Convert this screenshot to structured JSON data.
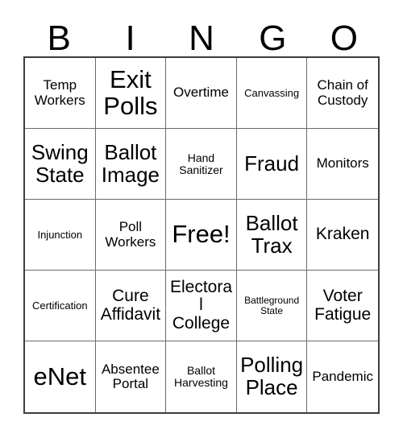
{
  "card": {
    "title": "BINGO",
    "header_letters": [
      "B",
      "I",
      "N",
      "G",
      "O"
    ],
    "colors": {
      "background": "#ffffff",
      "text": "#000000",
      "outer_border": "#3d3d3d",
      "inner_gridline": "#6b6b6b"
    },
    "grid": {
      "columns": 5,
      "rows": 5,
      "free_space": "Free!"
    },
    "cells": [
      {
        "label": "Temp Workers",
        "size": "lg",
        "lines": [
          "Temp",
          "Workers"
        ]
      },
      {
        "label": "Exit Polls",
        "size": "huge",
        "lines": [
          "Exit",
          "Polls"
        ]
      },
      {
        "label": "Overtime",
        "size": "lg",
        "lines": [
          "Overtime"
        ]
      },
      {
        "label": "Canvassing",
        "size": "sm",
        "lines": [
          "Canvassing"
        ]
      },
      {
        "label": "Chain of Custody",
        "size": "lg",
        "lines": [
          "Chain of",
          "Custody"
        ]
      },
      {
        "label": "Swing State",
        "size": "xxl",
        "lines": [
          "Swing",
          "State"
        ]
      },
      {
        "label": "Ballot Image",
        "size": "xxl",
        "lines": [
          "Ballot",
          "Image"
        ]
      },
      {
        "label": "Hand Sanitizer",
        "size": "md",
        "lines": [
          "Hand",
          "Sanitizer"
        ]
      },
      {
        "label": "Fraud",
        "size": "xxl",
        "lines": [
          "Fraud"
        ]
      },
      {
        "label": "Monitors",
        "size": "lg",
        "lines": [
          "Monitors"
        ]
      },
      {
        "label": "Injunction",
        "size": "sm",
        "lines": [
          "Injunction"
        ]
      },
      {
        "label": "Poll Workers",
        "size": "lg",
        "lines": [
          "Poll",
          "Workers"
        ]
      },
      {
        "label": "Free!",
        "size": "huge",
        "lines": [
          "Free!"
        ]
      },
      {
        "label": "Ballot Trax",
        "size": "xxl",
        "lines": [
          "Ballot",
          "Trax"
        ]
      },
      {
        "label": "Kraken",
        "size": "xl",
        "lines": [
          "Kraken"
        ]
      },
      {
        "label": "Certification",
        "size": "sm",
        "lines": [
          "Certification"
        ]
      },
      {
        "label": "Cure Affidavit",
        "size": "xl",
        "lines": [
          "Cure",
          "Affidavit"
        ]
      },
      {
        "label": "Electoral College",
        "size": "xl",
        "lines": [
          "Electoral",
          "College"
        ]
      },
      {
        "label": "Battleground State",
        "size": "xs",
        "lines": [
          "Battleground",
          "State"
        ]
      },
      {
        "label": "Voter Fatigue",
        "size": "xl",
        "lines": [
          "Voter",
          "Fatigue"
        ]
      },
      {
        "label": "eNet",
        "size": "huge",
        "lines": [
          "eNet"
        ]
      },
      {
        "label": "Absentee Portal",
        "size": "lg",
        "lines": [
          "Absentee",
          "Portal"
        ]
      },
      {
        "label": "Ballot Harvesting",
        "size": "md",
        "lines": [
          "Ballot",
          "Harvesting"
        ]
      },
      {
        "label": "Polling Place",
        "size": "xxl",
        "lines": [
          "Polling",
          "Place"
        ]
      },
      {
        "label": "Pandemic",
        "size": "lg",
        "lines": [
          "Pandemic"
        ]
      }
    ]
  }
}
